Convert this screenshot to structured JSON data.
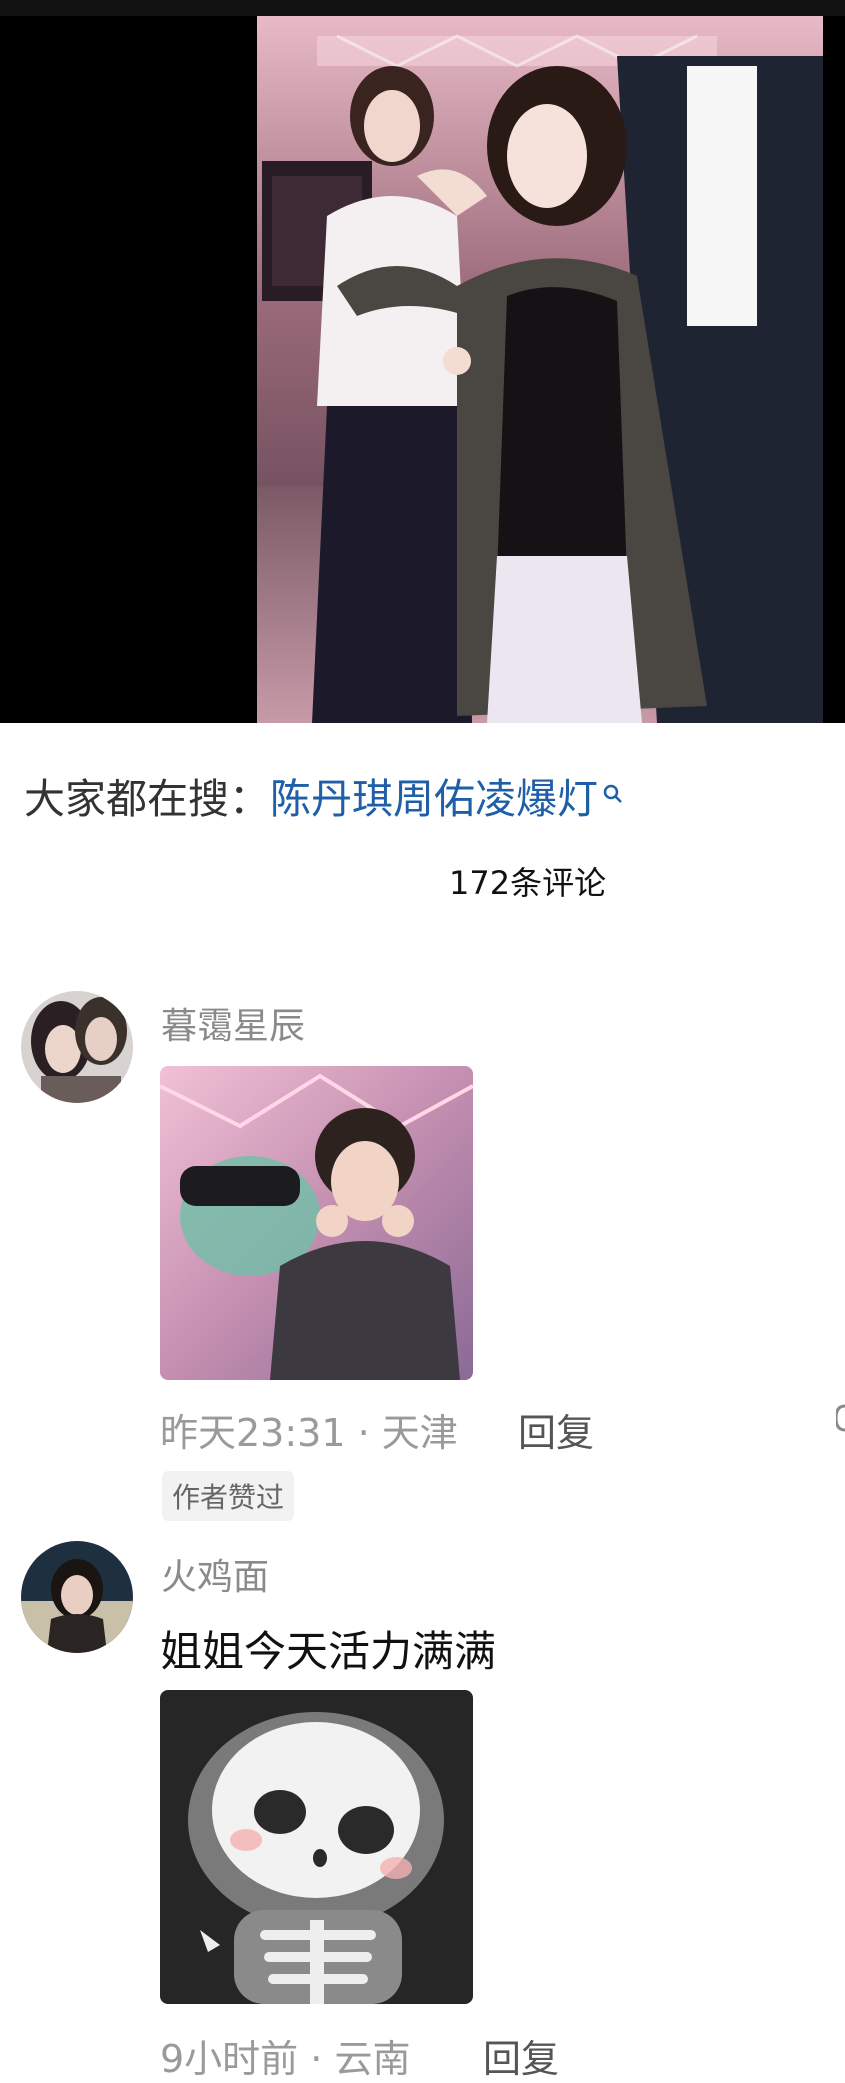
{
  "search": {
    "prefix": "大家都在搜：",
    "keyword": "陈丹琪周佑凌爆灯"
  },
  "comments_header": {
    "count_label": "172条评论"
  },
  "comments": [
    {
      "username": "暮霭星辰",
      "time": "昨天23:31",
      "separator": "·",
      "location": "天津",
      "reply_label": "回复",
      "badge": "作者赞过"
    },
    {
      "username": "火鸡面",
      "text": "姐姐今天活力满满",
      "time": "9小时前",
      "separator": "·",
      "location": "云南",
      "reply_label": "回复"
    }
  ],
  "icons": {
    "search": "search-icon",
    "avatar": "avatar",
    "image": "image"
  },
  "colors": {
    "keyword": "#1e5fa8",
    "meta": "#9a9a9a"
  }
}
